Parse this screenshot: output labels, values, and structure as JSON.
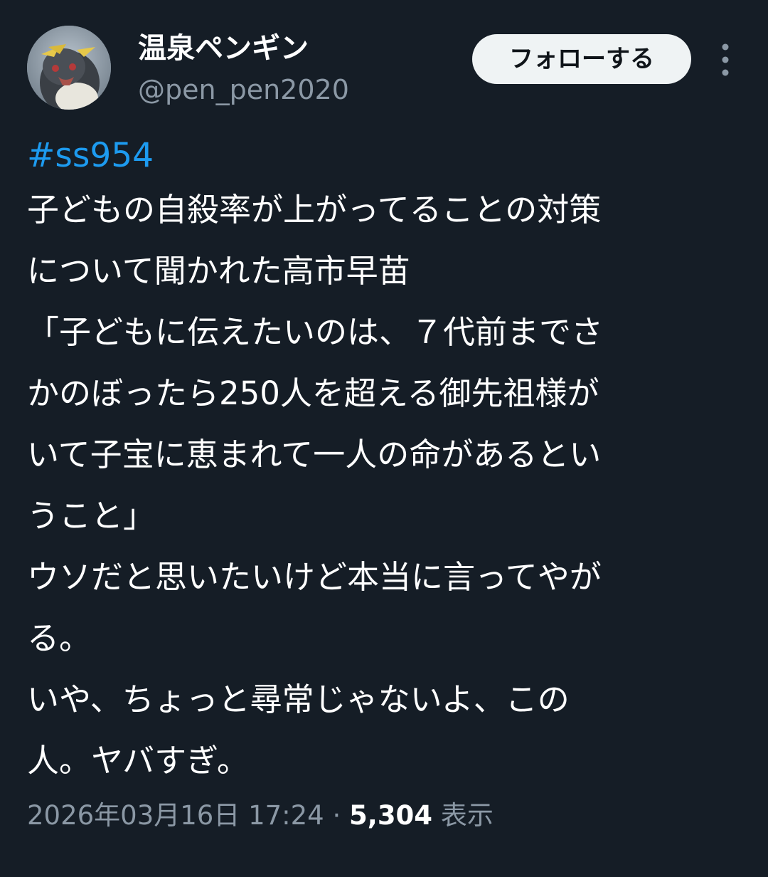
{
  "author": {
    "display_name": "温泉ペンギン",
    "handle": "@pen_pen2020",
    "avatar_icon": "penguin-avatar"
  },
  "actions": {
    "follow_label": "フォローする",
    "more_icon": "more-vertical-icon"
  },
  "tweet": {
    "hashtag": "#ss954",
    "lines": [
      "子どもの自殺率が上がってることの対策",
      "について聞かれた高市早苗",
      "「子どもに伝えたいのは、７代前までさ",
      "かのぼったら250人を超える御先祖様が",
      "いて子宝に恵まれて一人の命があるとい",
      "うこと」",
      "ウソだと思いたいけど本当に言ってやが",
      "る。",
      "いや、ちょっと尋常じゃないよ、この",
      "人。ヤバすぎ。"
    ]
  },
  "meta": {
    "timestamp": "2026年03月16日 17:24",
    "separator": "·",
    "views_count": "5,304",
    "views_label": "表示"
  },
  "colors": {
    "background": "#151d26",
    "text": "#ffffff",
    "secondary_text": "#8b98a5",
    "link": "#1d9bf0",
    "follow_button_bg": "#eff3f4"
  }
}
